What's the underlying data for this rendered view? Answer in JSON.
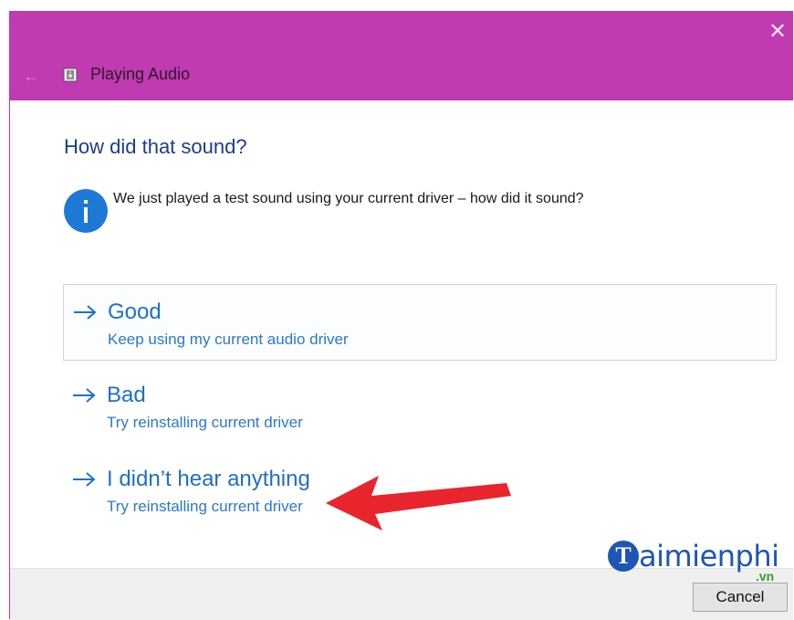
{
  "window": {
    "title": "Playing Audio",
    "back_icon": "back-arrow-icon",
    "close_icon": "close-icon",
    "title_bar_color": "#c03ab1"
  },
  "content": {
    "heading": "How did that sound?",
    "info_icon": "info-icon",
    "info_text": "We just played a test sound using your current driver – how did it sound?",
    "options": [
      {
        "title": "Good",
        "description": "Keep using my current audio driver",
        "selected": true
      },
      {
        "title": "Bad",
        "description": "Try reinstalling current driver",
        "selected": false
      },
      {
        "title": "I didn’t hear anything",
        "description": "Try reinstalling current driver",
        "selected": false
      }
    ]
  },
  "footer": {
    "cancel_label": "Cancel"
  },
  "annotation": {
    "arrow_color": "#e8242c",
    "points_to": "I didn’t hear anything"
  },
  "watermark": {
    "logo_letter": "T",
    "text": "aimienphi",
    "suffix": ".vn"
  },
  "colors": {
    "link_blue": "#1f6fc9",
    "heading_blue": "#1b3d8f",
    "info_blue": "#1e78d6"
  }
}
